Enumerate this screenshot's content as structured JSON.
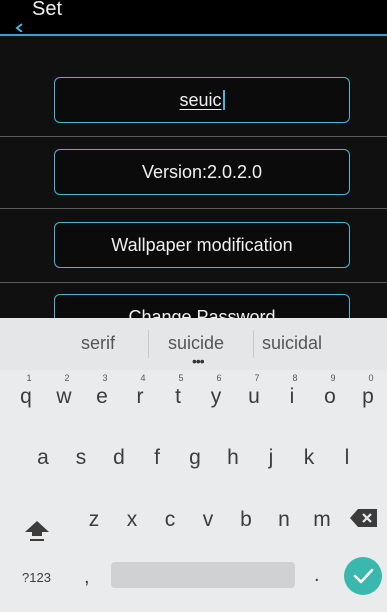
{
  "app": {
    "title": "Set",
    "input": {
      "value": "seuic"
    },
    "version_label": "Version:2.0.2.0",
    "wallpaper_label": "Wallpaper modification",
    "password_label": "Change Password"
  },
  "keyboard": {
    "suggestions": [
      "serif",
      "suicide",
      "suicidal"
    ],
    "row1": [
      {
        "key": "q",
        "hint": "1"
      },
      {
        "key": "w",
        "hint": "2"
      },
      {
        "key": "e",
        "hint": "3"
      },
      {
        "key": "r",
        "hint": "4"
      },
      {
        "key": "t",
        "hint": "5"
      },
      {
        "key": "y",
        "hint": "6"
      },
      {
        "key": "u",
        "hint": "7"
      },
      {
        "key": "i",
        "hint": "8"
      },
      {
        "key": "o",
        "hint": "9"
      },
      {
        "key": "p",
        "hint": "0"
      }
    ],
    "row2": [
      "a",
      "s",
      "d",
      "f",
      "g",
      "h",
      "j",
      "k",
      "l"
    ],
    "row3": [
      "z",
      "x",
      "c",
      "v",
      "b",
      "n",
      "m"
    ],
    "symbols_label": "?123",
    "comma": ",",
    "period": ".",
    "accent_color": "#3bb8ad"
  }
}
